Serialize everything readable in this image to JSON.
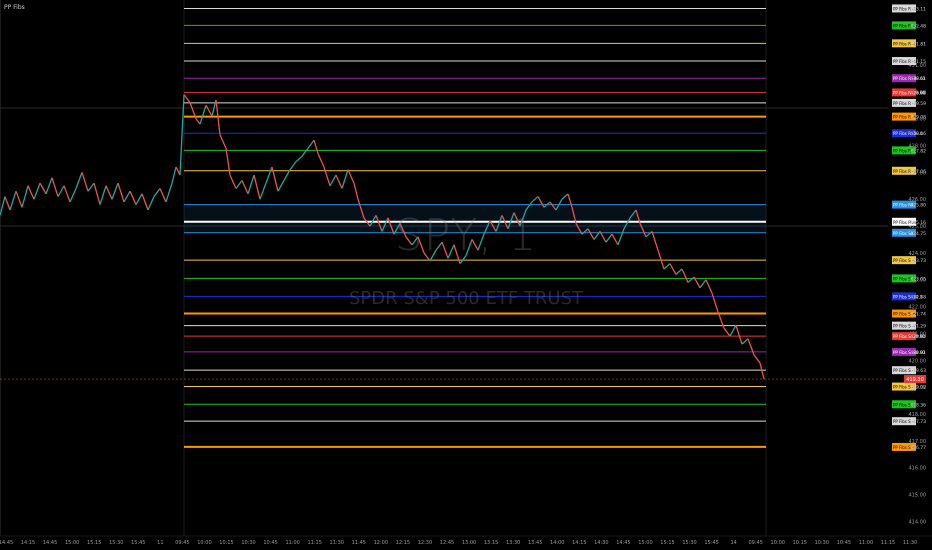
{
  "indicator_name": "PP Fibs",
  "watermark": {
    "symbol": "SPY, 1",
    "name": "SPDR S&P 500 ETF TRUST"
  },
  "chart_data": {
    "type": "line",
    "title": "",
    "ylim": [
      413.6,
      433.35
    ],
    "y_ticks": [
      "431.00",
      "430.00",
      "429.00",
      "428.00",
      "427.00",
      "426.00",
      "425.00",
      "424.00",
      "423.00",
      "422.00",
      "421.00",
      "420.00",
      "419.00",
      "418.00",
      "417.00",
      "416.00",
      "415.00",
      "414.00"
    ],
    "x_ticks": [
      "14:45",
      "14:15",
      "14:45",
      "15:00",
      "15:15",
      "15:30",
      "15:45",
      "11",
      "09:45",
      "10:00",
      "10:15",
      "10:30",
      "10:45",
      "11:00",
      "11:15",
      "11:30",
      "11:45",
      "12:00",
      "12:15",
      "12:30",
      "12:45",
      "13:00",
      "13:15",
      "13:30",
      "13:45",
      "14:00",
      "14:15",
      "14:30",
      "14:45",
      "15:00",
      "15:15",
      "15:30",
      "15:45",
      "14",
      "09:45",
      "10:00",
      "10:15",
      "10:30",
      "10:45",
      "11:00",
      "11:15",
      "11:30"
    ],
    "current_price": {
      "label": "419.30",
      "value": 419.3,
      "color": "#e53935"
    },
    "levels": [
      {
        "label": "PP Fibs R -141.4",
        "value": 433.11,
        "color": "#d9d9d9"
      },
      {
        "label": "PP Fibs R -127.2",
        "value": 432.48,
        "color": "#21c321"
      },
      {
        "label": "PP Fibs R -113.0",
        "value": 431.81,
        "color": "#f2c744"
      },
      {
        "label": "PP Fibs R -100.0",
        "value": 431.15,
        "color": "#d9d9d9"
      },
      {
        "label": "PP Fibs R -88.60",
        "value": 430.51,
        "color": "#9c27b0"
      },
      {
        "label": "PP Fibs R -78.60",
        "value": 429.98,
        "color": "#e53935"
      },
      {
        "label": "PP Fibs R -70.70",
        "value": 429.59,
        "color": "#d9d9d9"
      },
      {
        "label": "PP Fibs R -61.80",
        "value": 429.08,
        "color": "#ff9800"
      },
      {
        "label": "PP Fibs R -50.0",
        "value": 428.46,
        "color": "#1e2fd6"
      },
      {
        "label": "PP Fibs R -38.20",
        "value": 427.82,
        "color": "#21c321"
      },
      {
        "label": "PP Fibs R -23.60",
        "value": 427.06,
        "color": "#f2c744"
      },
      {
        "label": "PP Fibs R0",
        "value": 425.8,
        "color": "#2a8fe0"
      },
      {
        "label": "PP Fibs Pivot",
        "value": 425.16,
        "color": "#ffffff"
      },
      {
        "label": "PP Fibs S0",
        "value": 424.75,
        "color": "#2a8fe0"
      },
      {
        "label": "PP Fibs S -23.60",
        "value": 423.73,
        "color": "#f2c744"
      },
      {
        "label": "PP Fibs S -38.20",
        "value": 423.05,
        "color": "#21c321"
      },
      {
        "label": "PP Fibs S -50.0",
        "value": 422.38,
        "color": "#1e2fd6"
      },
      {
        "label": "PP Fibs S -61.80",
        "value": 421.74,
        "color": "#ff9800"
      },
      {
        "label": "PP Fibs S -70.70",
        "value": 421.29,
        "color": "#d9d9d9"
      },
      {
        "label": "PP Fibs S -78.60",
        "value": 420.9,
        "color": "#e53935"
      },
      {
        "label": "PP Fibs S -88.60",
        "value": 420.31,
        "color": "#9c27b0"
      },
      {
        "label": "PP Fibs S -100.0",
        "value": 419.63,
        "color": "#d9d9d9"
      },
      {
        "label": "PP Fibs S -113.0",
        "value": 419.02,
        "color": "#f2c744"
      },
      {
        "label": "PP Fibs S -127.2",
        "value": 418.36,
        "color": "#21c321"
      },
      {
        "label": "PP Fibs S -141.40",
        "value": 417.73,
        "color": "#d9d9d9"
      },
      {
        "label": "PP Fibs S -161.80",
        "value": 416.77,
        "color": "#ff9800"
      }
    ],
    "price_path": [
      [
        0,
        425.4
      ],
      [
        5,
        426.1
      ],
      [
        10,
        425.6
      ],
      [
        16,
        426.3
      ],
      [
        22,
        425.7
      ],
      [
        28,
        426.5
      ],
      [
        34,
        426.0
      ],
      [
        40,
        426.6
      ],
      [
        46,
        426.2
      ],
      [
        52,
        426.8
      ],
      [
        58,
        426.1
      ],
      [
        64,
        426.5
      ],
      [
        70,
        425.9
      ],
      [
        76,
        426.4
      ],
      [
        82,
        427.0
      ],
      [
        88,
        426.3
      ],
      [
        94,
        426.6
      ],
      [
        100,
        425.8
      ],
      [
        106,
        426.5
      ],
      [
        112,
        426.0
      ],
      [
        118,
        426.6
      ],
      [
        124,
        425.9
      ],
      [
        130,
        426.3
      ],
      [
        136,
        425.8
      ],
      [
        142,
        426.2
      ],
      [
        148,
        425.6
      ],
      [
        154,
        426.1
      ],
      [
        160,
        426.4
      ],
      [
        166,
        425.9
      ],
      [
        172,
        426.6
      ],
      [
        176,
        427.2
      ],
      [
        180,
        426.9
      ],
      [
        184,
        429.9
      ],
      [
        190,
        429.6
      ],
      [
        196,
        429.0
      ],
      [
        200,
        428.8
      ],
      [
        206,
        429.5
      ],
      [
        212,
        429.1
      ],
      [
        216,
        429.7
      ],
      [
        220,
        428.4
      ],
      [
        226,
        427.9
      ],
      [
        230,
        426.9
      ],
      [
        236,
        426.4
      ],
      [
        242,
        426.7
      ],
      [
        248,
        426.2
      ],
      [
        254,
        426.9
      ],
      [
        260,
        426.0
      ],
      [
        266,
        426.6
      ],
      [
        272,
        427.2
      ],
      [
        278,
        426.3
      ],
      [
        284,
        426.7
      ],
      [
        290,
        427.1
      ],
      [
        296,
        427.4
      ],
      [
        302,
        427.6
      ],
      [
        308,
        427.9
      ],
      [
        314,
        428.2
      ],
      [
        318,
        427.7
      ],
      [
        324,
        427.2
      ],
      [
        330,
        426.5
      ],
      [
        336,
        426.9
      ],
      [
        342,
        426.4
      ],
      [
        348,
        427.1
      ],
      [
        354,
        426.6
      ],
      [
        358,
        426.0
      ],
      [
        364,
        425.3
      ],
      [
        370,
        425.0
      ],
      [
        376,
        425.4
      ],
      [
        382,
        424.8
      ],
      [
        388,
        425.3
      ],
      [
        394,
        424.7
      ],
      [
        400,
        425.1
      ],
      [
        406,
        424.6
      ],
      [
        412,
        424.3
      ],
      [
        418,
        424.6
      ],
      [
        424,
        424.0
      ],
      [
        430,
        423.7
      ],
      [
        436,
        424.1
      ],
      [
        442,
        424.4
      ],
      [
        448,
        423.8
      ],
      [
        454,
        424.3
      ],
      [
        460,
        423.6
      ],
      [
        466,
        423.9
      ],
      [
        472,
        424.5
      ],
      [
        478,
        424.1
      ],
      [
        484,
        424.7
      ],
      [
        490,
        425.2
      ],
      [
        496,
        424.8
      ],
      [
        502,
        425.4
      ],
      [
        508,
        424.9
      ],
      [
        514,
        425.5
      ],
      [
        520,
        425.0
      ],
      [
        526,
        425.6
      ],
      [
        532,
        425.9
      ],
      [
        538,
        426.1
      ],
      [
        544,
        425.7
      ],
      [
        550,
        425.9
      ],
      [
        556,
        425.6
      ],
      [
        562,
        426.0
      ],
      [
        568,
        426.2
      ],
      [
        572,
        425.7
      ],
      [
        576,
        425.1
      ],
      [
        582,
        424.7
      ],
      [
        588,
        424.9
      ],
      [
        594,
        424.5
      ],
      [
        600,
        424.8
      ],
      [
        606,
        424.4
      ],
      [
        612,
        424.7
      ],
      [
        618,
        424.3
      ],
      [
        624,
        424.9
      ],
      [
        630,
        425.3
      ],
      [
        636,
        425.6
      ],
      [
        640,
        425.1
      ],
      [
        646,
        424.6
      ],
      [
        652,
        424.8
      ],
      [
        658,
        424.1
      ],
      [
        664,
        423.4
      ],
      [
        670,
        423.6
      ],
      [
        676,
        423.2
      ],
      [
        682,
        423.4
      ],
      [
        688,
        422.9
      ],
      [
        694,
        423.1
      ],
      [
        700,
        422.7
      ],
      [
        706,
        423.0
      ],
      [
        712,
        422.5
      ],
      [
        718,
        421.8
      ],
      [
        724,
        421.2
      ],
      [
        730,
        420.9
      ],
      [
        736,
        421.3
      ],
      [
        742,
        420.6
      ],
      [
        748,
        420.8
      ],
      [
        754,
        420.2
      ],
      [
        760,
        419.9
      ],
      [
        764,
        419.3
      ]
    ]
  }
}
